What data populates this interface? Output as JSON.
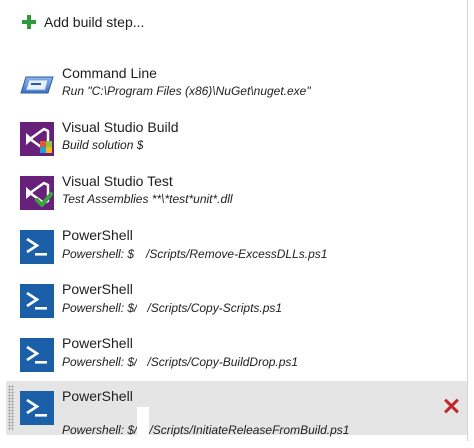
{
  "toolbar": {
    "add_label": "Add build step...",
    "add_icon": "plus-icon",
    "accent": "#2e9a3b"
  },
  "steps": [
    {
      "title": "Command Line",
      "desc_prefix": "Run \"C:\\Program Files (x86)\\NuGet\\nuget.exe\"",
      "desc_suffix": "",
      "icon": "command-line-icon"
    },
    {
      "title": "Visual Studio Build",
      "desc_prefix": "Build solution ",
      "desc_suffix": "",
      "icon": "visual-studio-build-icon"
    },
    {
      "title": "Visual Studio Test",
      "desc_prefix": "Test Assemblies **\\*test*unit*.dll",
      "desc_suffix": "",
      "icon": "visual-studio-test-icon"
    },
    {
      "title": "PowerShell",
      "desc_prefix": "Powershell: $",
      "desc_suffix": "/Scripts/Remove-ExcessDLLs.ps1",
      "icon": "powershell-icon"
    },
    {
      "title": "PowerShell",
      "desc_prefix": "Powershell: $/",
      "desc_suffix": "/Scripts/Copy-Scripts.ps1",
      "icon": "powershell-icon"
    },
    {
      "title": "PowerShell",
      "desc_prefix": "Powershell: $/",
      "desc_suffix": "/Scripts/Copy-BuildDrop.ps1",
      "icon": "powershell-icon"
    },
    {
      "title": "PowerShell",
      "desc_prefix": "Powershell: $/",
      "desc_suffix": "/Scripts/InitiateReleaseFromBuild.ps1",
      "icon": "powershell-icon",
      "selected": true
    }
  ],
  "colors": {
    "selected_row": "#e5e5e5",
    "delete": "#c0272d",
    "powershell": "#1b5fa8",
    "visual_studio": "#68217a"
  }
}
